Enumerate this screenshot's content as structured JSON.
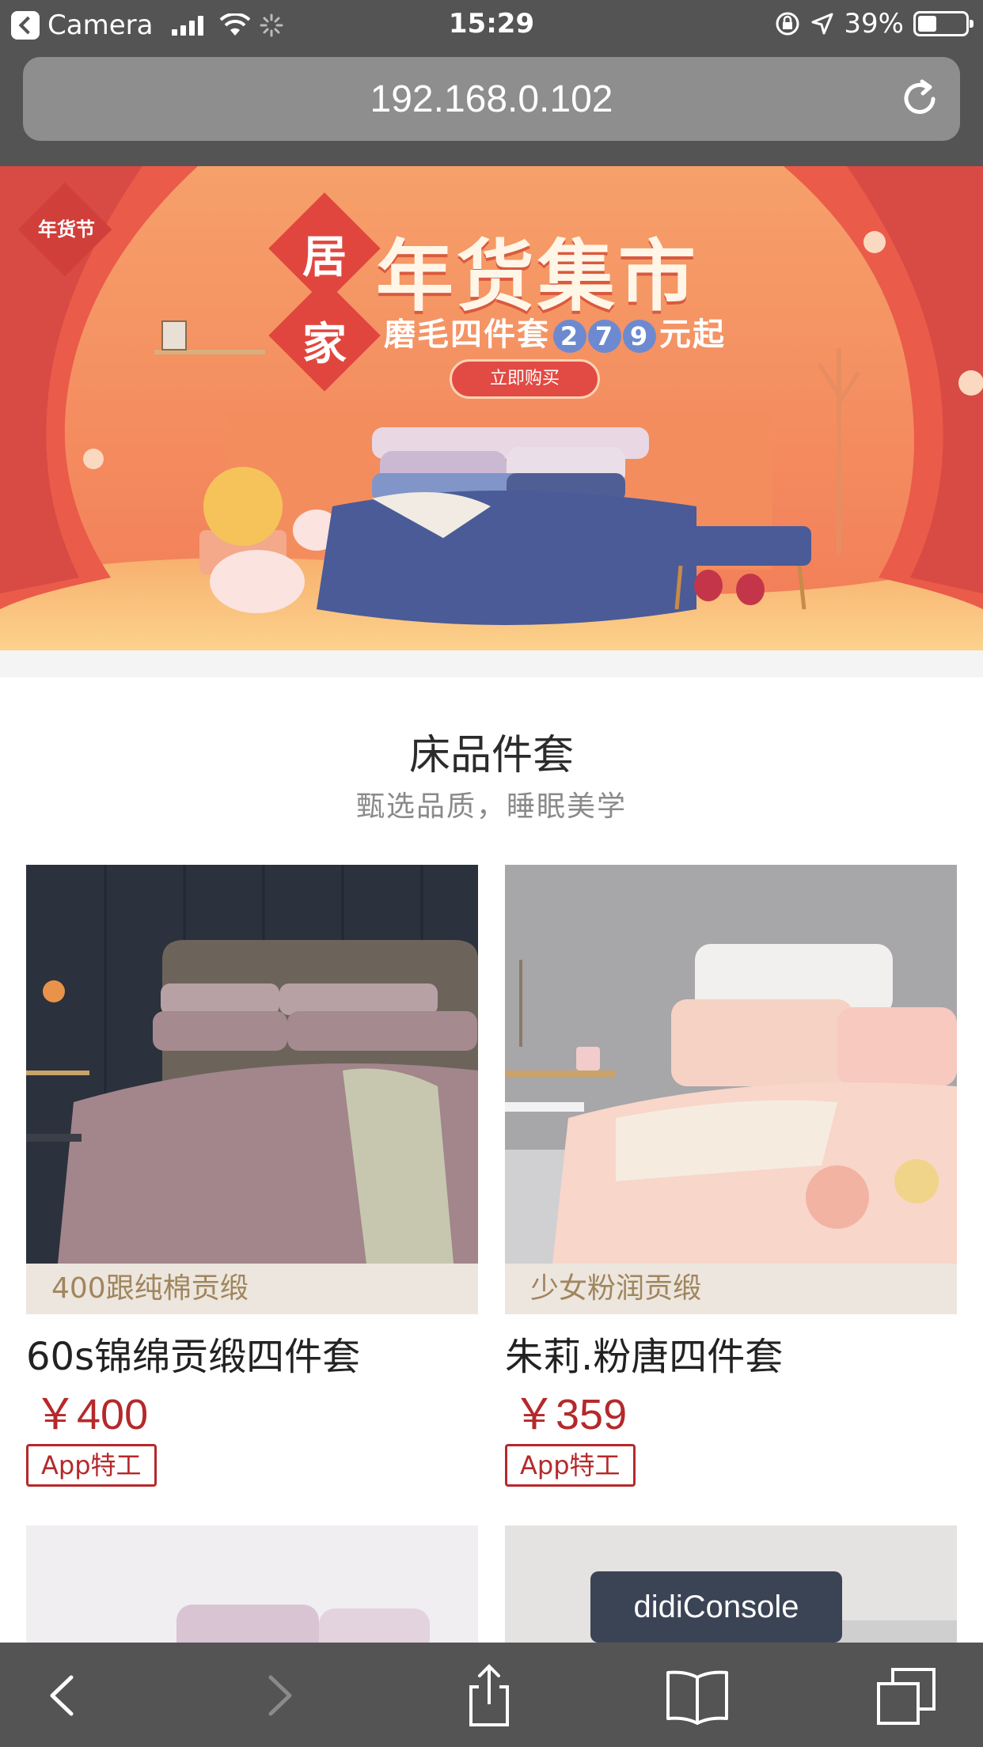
{
  "status_bar": {
    "back_app": "Camera",
    "time": "15:29",
    "battery": "39%",
    "battery_level": 0.39
  },
  "browser": {
    "url": "192.168.0.102"
  },
  "banner": {
    "corner_tag": "年货节",
    "side_char_1": "居",
    "side_char_2": "家",
    "title": "年货集市",
    "subtitle_prefix": "磨毛四件套",
    "price_digits": [
      "2",
      "7",
      "9"
    ],
    "subtitle_suffix": "元起",
    "cta": "立即购买"
  },
  "section": {
    "title": "床品件套",
    "subtitle": "甄选品质，睡眠美学"
  },
  "products": [
    {
      "tag": "400跟纯棉贡缎",
      "name": "60s锦绵贡缎四件套",
      "price": "￥400",
      "badge": "App特工"
    },
    {
      "tag": "少女粉润贡缎",
      "name": "朱莉.粉唐四件套",
      "price": "￥359",
      "badge": "App特工"
    }
  ],
  "console": {
    "label": "didiConsole"
  },
  "colors": {
    "chrome": "#545454",
    "price_red": "#b5292b",
    "tag_bg": "#ede6de",
    "tag_text": "#a0865d",
    "console_bg": "#3b4455"
  },
  "icons": {
    "toolbar": [
      "back-icon",
      "forward-icon",
      "share-icon",
      "bookmarks-icon",
      "tabs-icon"
    ]
  }
}
